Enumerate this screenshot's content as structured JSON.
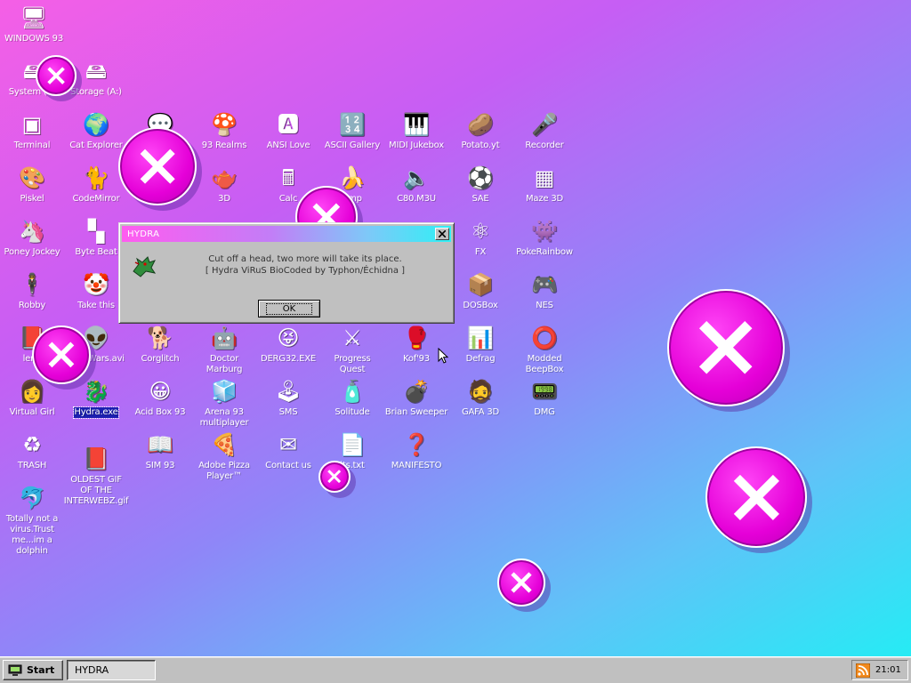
{
  "window_title": "Windows 93",
  "desktop_icons": [
    {
      "name": "windows-93-icon",
      "label": "WINDOWS 93",
      "glyph": "🖥"
    },
    {
      "name": "system-drive-icon",
      "label": "System (C:)",
      "glyph": "🖴"
    },
    {
      "name": "storage-drive-icon",
      "label": "Storage (A:)",
      "glyph": "🖴"
    },
    {
      "name": "terminal-icon",
      "label": "Terminal",
      "glyph": "▣"
    },
    {
      "name": "cat-explorer-icon",
      "label": "Cat Explorer",
      "glyph": "🌍"
    },
    {
      "name": "chat-icon",
      "label": "",
      "glyph": "💬"
    },
    {
      "name": "93-realms-icon",
      "label": "93 Realms",
      "glyph": "🍄"
    },
    {
      "name": "ansi-love-icon",
      "label": "ANSI Love",
      "glyph": "🅰"
    },
    {
      "name": "ascii-gallery-icon",
      "label": "ASCII Gallery",
      "glyph": "🔢"
    },
    {
      "name": "midi-jukebox-icon",
      "label": "MIDI Jukebox",
      "glyph": "🎹"
    },
    {
      "name": "potato-yt-icon",
      "label": "Potato.yt",
      "glyph": "🥔"
    },
    {
      "name": "recorder-icon",
      "label": "Recorder",
      "glyph": "🎤"
    },
    {
      "name": "piskel-icon",
      "label": "Piskel",
      "glyph": "🎨"
    },
    {
      "name": "codemirror-icon",
      "label": "CodeMirror",
      "glyph": "🐈"
    },
    {
      "name": "3d-icon",
      "label": "3D",
      "glyph": "🫖"
    },
    {
      "name": "calc-icon",
      "label": "Calc",
      "glyph": "🖩"
    },
    {
      "name": "winamp-icon",
      "label": "amp",
      "glyph": "🍌"
    },
    {
      "name": "c80-m3u-icon",
      "label": "C80.M3U",
      "glyph": "🔈"
    },
    {
      "name": "sae-icon",
      "label": "SAE",
      "glyph": "⚽"
    },
    {
      "name": "maze-3d-icon",
      "label": "Maze 3D",
      "glyph": "▦"
    },
    {
      "name": "poney-jockey-icon",
      "label": "Poney Jockey",
      "glyph": "🦄"
    },
    {
      "name": "byte-beat-icon",
      "label": "Byte Beat",
      "glyph": "▚"
    },
    {
      "name": "fx-icon",
      "label": "FX",
      "glyph": "⚛"
    },
    {
      "name": "pokerainbow-icon",
      "label": "PokeRainbow",
      "glyph": "👾"
    },
    {
      "name": "robby-icon",
      "label": "Robby",
      "glyph": "🕴"
    },
    {
      "name": "take-this-icon",
      "label": "Take this",
      "glyph": "🤡"
    },
    {
      "name": "dosbox-icon",
      "label": "DOSBox",
      "glyph": "📦"
    },
    {
      "name": "nes-icon",
      "label": "NES",
      "glyph": "🎮"
    },
    {
      "name": "lennyface-icon",
      "label": "lenn",
      "glyph": "📕"
    },
    {
      "name": "star-wars-icon",
      "label": "Star Wars.avi",
      "glyph": "👽"
    },
    {
      "name": "corglitch-icon",
      "label": "Corglitch",
      "glyph": "🐕"
    },
    {
      "name": "doctor-marburg-icon",
      "label": "Doctor Marburg",
      "glyph": "🤖"
    },
    {
      "name": "derg32-icon",
      "label": "DERG32.EXE",
      "glyph": "😝"
    },
    {
      "name": "progress-quest-icon",
      "label": "Progress Quest",
      "glyph": "⚔"
    },
    {
      "name": "kof93-icon",
      "label": "Kof'93",
      "glyph": "🥊"
    },
    {
      "name": "defrag-icon",
      "label": "Defrag",
      "glyph": "📊"
    },
    {
      "name": "modded-beepbox-icon",
      "label": "Modded BeepBox",
      "glyph": "⭕"
    },
    {
      "name": "virtual-girl-icon",
      "label": "Virtual Girl",
      "glyph": "👩"
    },
    {
      "name": "hydra-exe-icon",
      "label": "Hydra.exe",
      "glyph": "🐉"
    },
    {
      "name": "acid-box-93-icon",
      "label": "Acid Box 93",
      "glyph": "😀"
    },
    {
      "name": "arena-93-icon",
      "label": "Arena 93 multiplayer",
      "glyph": "🧊"
    },
    {
      "name": "sms-icon",
      "label": "SMS",
      "glyph": "🕹"
    },
    {
      "name": "solitude-icon",
      "label": "Solitude",
      "glyph": "🧴"
    },
    {
      "name": "brian-sweeper-icon",
      "label": "Brian Sweeper",
      "glyph": "💣"
    },
    {
      "name": "gafa-3d-icon",
      "label": "GAFA 3D",
      "glyph": "🧔"
    },
    {
      "name": "dmg-icon",
      "label": "DMG",
      "glyph": "📟"
    },
    {
      "name": "trash-icon",
      "label": "TRASH",
      "glyph": "♻"
    },
    {
      "name": "sim93-icon",
      "label": "SIM 93",
      "glyph": "📖"
    },
    {
      "name": "adobe-pizza-icon",
      "label": "Adobe Pizza Player™",
      "glyph": "🍕"
    },
    {
      "name": "contact-us-icon",
      "label": "Contact us",
      "glyph": "✉"
    },
    {
      "name": "credits-txt-icon",
      "label": "its.txt",
      "glyph": "📄"
    },
    {
      "name": "manifesto-icon",
      "label": "MANIFESTO",
      "glyph": "❓"
    },
    {
      "name": "oldest-gif-icon",
      "label": "OLDEST GIF OF THE INTERWEBZ.gif",
      "glyph": "📕"
    },
    {
      "name": "dolphin-icon",
      "label": "Totally not a virus.Trust me...im a dolphin",
      "glyph": "🐬"
    }
  ],
  "dialog": {
    "title": "HYDRA",
    "message_line1": "Cut off a head, two more will take its place.",
    "message_line2": "[ Hydra ViRuS BioCoded by Typhon/Échidna ]",
    "ok_label": "OK"
  },
  "taskbar": {
    "start_label": "Start",
    "task_label": "HYDRA",
    "clock": "21:01"
  },
  "colors": {
    "x_circle": "#e500d8",
    "selection": "#1c1fb0"
  }
}
